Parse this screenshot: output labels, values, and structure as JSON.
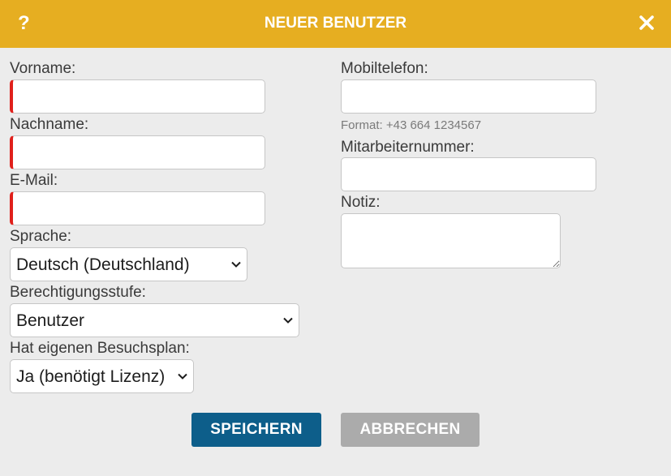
{
  "dialog": {
    "title": "NEUER BENUTZER",
    "help_label": "?",
    "accent_color": "#e6ae21",
    "required_marker_color": "#e0201b"
  },
  "left": {
    "first_name": {
      "label": "Vorname:",
      "value": ""
    },
    "last_name": {
      "label": "Nachname:",
      "value": ""
    },
    "email": {
      "label": "E-Mail:",
      "value": ""
    },
    "language": {
      "label": "Sprache:",
      "selected": "Deutsch (Deutschland)"
    },
    "permission_level": {
      "label": "Berechtigungsstufe:",
      "selected": "Benutzer"
    },
    "own_visit_plan": {
      "label": "Hat eigenen Besuchsplan:",
      "selected": "Ja (benötigt Lizenz)"
    }
  },
  "right": {
    "mobile": {
      "label": "Mobiltelefon:",
      "value": "",
      "format_hint": "Format: +43 664 1234567"
    },
    "employee_number": {
      "label": "Mitarbeiternummer:",
      "value": ""
    },
    "note": {
      "label": "Notiz:",
      "value": ""
    }
  },
  "actions": {
    "save_label": "SPEICHERN",
    "cancel_label": "ABBRECHEN",
    "save_color": "#0d5e8a",
    "cancel_color": "#ababab"
  },
  "icons": {
    "help": "question-mark-icon",
    "close": "close-icon",
    "dropdown": "chevron-down-icon"
  }
}
